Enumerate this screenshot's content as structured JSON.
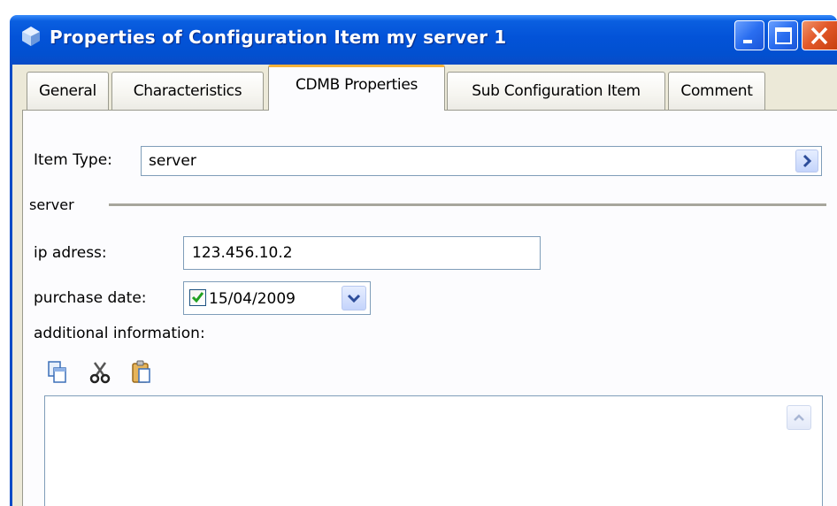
{
  "window": {
    "title": "Properties of Configuration Item my server 1",
    "icon": "gem-icon",
    "controls": {
      "minimize": "minimize-icon",
      "maximize": "maximize-icon",
      "close": "close-icon"
    }
  },
  "tabs": [
    {
      "label": "General",
      "active": false
    },
    {
      "label": "Characteristics",
      "active": false
    },
    {
      "label": "CDMB Properties",
      "active": true
    },
    {
      "label": "Sub Configuration Item",
      "active": false
    },
    {
      "label": "Comment",
      "active": false
    }
  ],
  "form": {
    "item_type_label": "Item Type:",
    "item_type_value": "server",
    "group_label": "server",
    "ip_label": "ip adress:",
    "ip_value": "123.456.10.2",
    "purchase_label": "purchase date:",
    "purchase_checked": true,
    "purchase_value": "15/04/2009",
    "additional_label": "additional information:",
    "additional_value": ""
  },
  "toolbar": {
    "copy_icon": "copy-icon",
    "cut_icon": "cut-icon",
    "paste_icon": "paste-icon"
  },
  "colors": {
    "titlebar": "#0353d8",
    "window_bg": "#ece9d8",
    "active_tab_accent": "#f6b13a",
    "field_border": "#7f9db9",
    "close_button": "#e2582a"
  }
}
